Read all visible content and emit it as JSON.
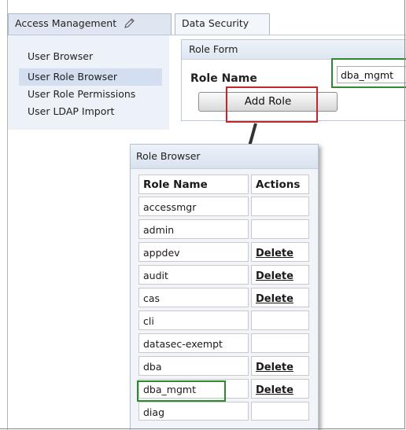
{
  "tabs": [
    {
      "label": "Access Management",
      "icon": "pencil-icon"
    },
    {
      "label": "Data Security"
    }
  ],
  "sidebar": {
    "items": [
      {
        "label": "User Browser"
      },
      {
        "label": "User Role Browser",
        "selected": true
      },
      {
        "label": "User Role Permissions"
      },
      {
        "label": "User LDAP Import"
      }
    ]
  },
  "role_form": {
    "title": "Role Form",
    "field_label": "Role Name",
    "input_value": "dba_mgmt",
    "button_label": "Add Role"
  },
  "role_browser": {
    "title": "Role Browser",
    "columns": [
      "Role Name",
      "Actions"
    ],
    "rows": [
      {
        "name": "accessmgr",
        "action": ""
      },
      {
        "name": "admin",
        "action": ""
      },
      {
        "name": "appdev",
        "action": "Delete"
      },
      {
        "name": "audit",
        "action": "Delete"
      },
      {
        "name": "cas",
        "action": "Delete"
      },
      {
        "name": "cli",
        "action": ""
      },
      {
        "name": "datasec-exempt",
        "action": ""
      },
      {
        "name": "dba",
        "action": "Delete"
      },
      {
        "name": "dba_mgmt",
        "action": "Delete"
      },
      {
        "name": "diag",
        "action": ""
      }
    ]
  },
  "colors": {
    "highlight_green": "#2f8a2f",
    "highlight_red": "#c0262c",
    "selected_bg": "#d3dff0"
  }
}
